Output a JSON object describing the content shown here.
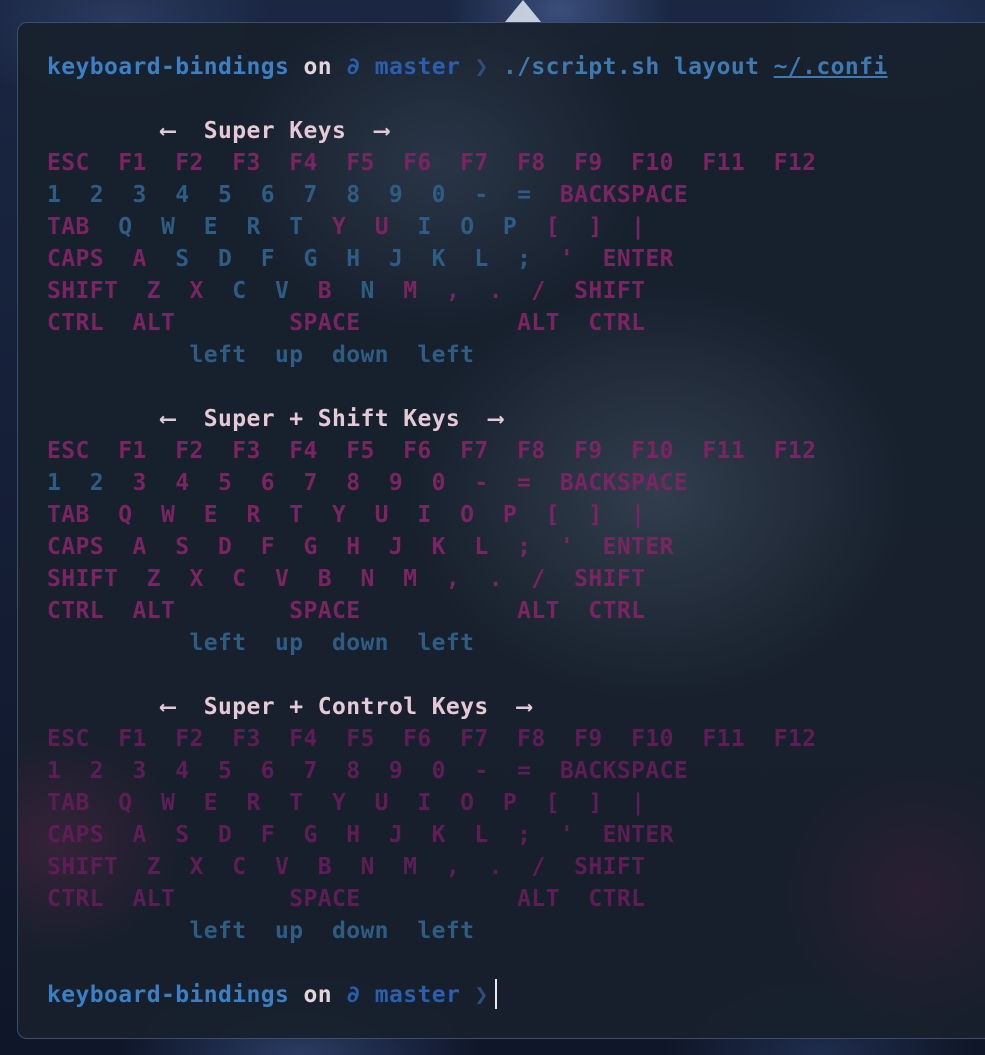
{
  "prompt": {
    "dir": "keyboard-bindings",
    "on": "on",
    "branch_icon": "∂",
    "branch": "master",
    "chevron": "❯",
    "command": "./script.sh layout",
    "path": "~/.confi"
  },
  "sections": [
    {
      "left_arrow": "⟵",
      "title": "Super Keys",
      "right_arrow": "⟶",
      "rows": [
        "ESC  F1  F2  F3  F4  F5  F6  F7  F8  F9  F10  F11  F12",
        "1  2  3  4  5  6  7  8  9  0  -  =  BACKSPACE",
        "TAB  Q  W  E  R  T  Y  U  I  O  P  [  ]  |",
        "CAPS  A  S  D  F  G  H  J  K  L  ;  '  ENTER",
        "SHIFT  Z  X  C  V  B  N  M  ,  .  /  SHIFT",
        "CTRL  ALT        SPACE           ALT  CTRL",
        "          left  up  down  left"
      ]
    },
    {
      "left_arrow": "⟵",
      "title": "Super + Shift Keys",
      "right_arrow": "⟶",
      "rows": [
        "ESC  F1  F2  F3  F4  F5  F6  F7  F8  F9  F10  F11  F12",
        "1  2  3  4  5  6  7  8  9  0  -  =  BACKSPACE",
        "TAB  Q  W  E  R  T  Y  U  I  O  P  [  ]  |",
        "CAPS  A  S  D  F  G  H  J  K  L  ;  '  ENTER",
        "SHIFT  Z  X  C  V  B  N  M  ,  .  /  SHIFT",
        "CTRL  ALT        SPACE           ALT  CTRL",
        "          left  up  down  left"
      ]
    },
    {
      "left_arrow": "⟵",
      "title": "Super + Control Keys",
      "right_arrow": "⟶",
      "rows": [
        "ESC  F1  F2  F3  F4  F5  F6  F7  F8  F9  F10  F11  F12",
        "1  2  3  4  5  6  7  8  9  0  -  =  BACKSPACE",
        "TAB  Q  W  E  R  T  Y  U  I  O  P  [  ]  |",
        "CAPS  A  S  D  F  G  H  J  K  L  ;  '  ENTER",
        "SHIFT  Z  X  C  V  B  N  M  ,  .  /  SHIFT",
        "CTRL  ALT        SPACE           ALT  CTRL",
        "          left  up  down  left"
      ]
    }
  ],
  "colors": {
    "highlight_magenta": "#7a2462",
    "highlight_blue": "#2f5c82",
    "title": "#e6c9d6",
    "prompt_dir": "#3b7fc4"
  }
}
